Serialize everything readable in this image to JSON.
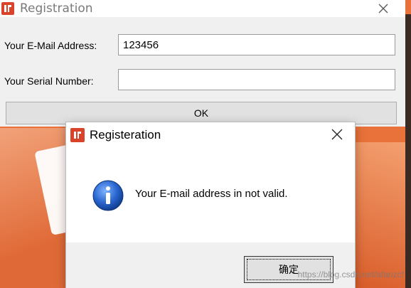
{
  "main_window": {
    "title": "Registration",
    "app_icon_glyph": "个",
    "email_label": "Your E-Mail Address:",
    "email_value": "123456",
    "serial_label": "Your Serial Number:",
    "serial_value": "",
    "ok_label": "OK"
  },
  "dialog": {
    "title": "Registeration",
    "message": "Your E-mail address in not valid.",
    "icon": "info-icon",
    "confirm_label": "确定"
  },
  "watermark": "https://blog.csdn.net/afanzcf",
  "colors": {
    "app_icon": "#d9432a",
    "background_accent": "#e8723a",
    "info_icon": "#1f5fbf"
  }
}
